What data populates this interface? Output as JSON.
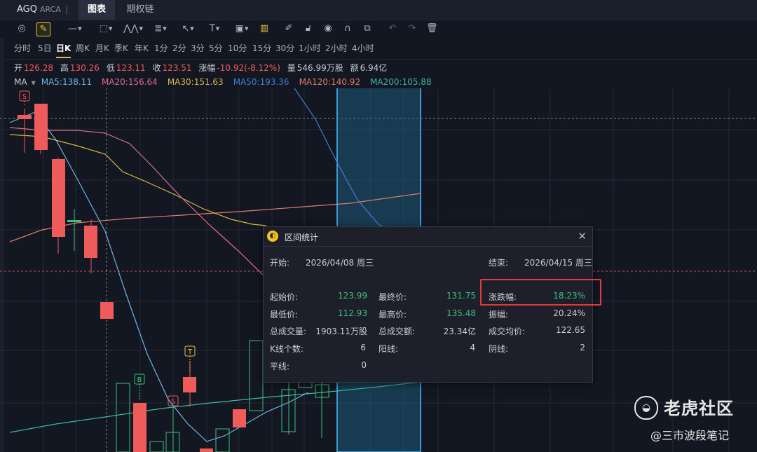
{
  "window": {
    "ticker": "AGQ",
    "exchange": "ARCA",
    "tabs": [
      {
        "label": "图表",
        "active": true
      },
      {
        "label": "期权链",
        "active": false
      }
    ]
  },
  "toolbar": {
    "icons": [
      "crosshair-icon",
      "draw-pen-icon",
      "line-icon",
      "rectangle-icon",
      "pattern-icon",
      "fib-icon",
      "arrow-icon",
      "text-icon",
      "annotation-icon",
      "indicator-icon",
      "brush-icon",
      "lock-icon",
      "eye-icon",
      "magnet-icon",
      "layers-icon",
      "undo-icon",
      "redo-icon",
      "trash-icon"
    ]
  },
  "periods": [
    {
      "label": "分时",
      "active": false
    },
    {
      "label": "5日",
      "active": false
    },
    {
      "label": "日K",
      "active": true
    },
    {
      "label": "周K",
      "active": false
    },
    {
      "label": "月K",
      "active": false
    },
    {
      "label": "季K",
      "active": false
    },
    {
      "label": "年K",
      "active": false
    },
    {
      "label": "1分",
      "active": false
    },
    {
      "label": "2分",
      "active": false
    },
    {
      "label": "3分",
      "active": false
    },
    {
      "label": "5分",
      "active": false
    },
    {
      "label": "10分",
      "active": false
    },
    {
      "label": "15分",
      "active": false
    },
    {
      "label": "30分",
      "active": false
    },
    {
      "label": "1小时",
      "active": false
    },
    {
      "label": "2小时",
      "active": false
    },
    {
      "label": "4小时",
      "active": false
    }
  ],
  "quote": {
    "open_label": "开",
    "open": "126.28",
    "high_label": "高",
    "high": "130.26",
    "low_label": "低",
    "low": "123.11",
    "close_label": "收",
    "close": "123.51",
    "change_label": "涨幅",
    "change": "-10.92(-8.12%)",
    "volume_label": "量",
    "volume": "546.99万股",
    "amount_label": "额",
    "amount": "6.94亿"
  },
  "ma": {
    "label": "MA",
    "items": [
      {
        "text": "MA5:138.11",
        "color": "#6fb3e6"
      },
      {
        "text": "MA20:156.64",
        "color": "#e06b8d"
      },
      {
        "text": "MA30:151.63",
        "color": "#d9b84a"
      },
      {
        "text": "MA50:193.36",
        "color": "#3f7fd1"
      },
      {
        "text": "MA120:140.92",
        "color": "#e07b6a"
      },
      {
        "text": "MA200:105.88",
        "color": "#3bb7a2"
      }
    ]
  },
  "markers": {
    "s_top": "S",
    "b": "B",
    "s_low": "S",
    "t": "T"
  },
  "dialog": {
    "title": "区间统计",
    "start_label": "开始:",
    "start": "2026/04/08 周三",
    "end_label": "结束:",
    "end": "2026/04/15 周三",
    "rows": [
      [
        {
          "label": "起始价:",
          "value": "123.99",
          "tone": "green"
        },
        {
          "label": "最终价:",
          "value": "131.75",
          "tone": "green"
        },
        {
          "label": "涨跌幅:",
          "value": "18.23%",
          "tone": "green"
        }
      ],
      [
        {
          "label": "最低价:",
          "value": "112.93",
          "tone": "green"
        },
        {
          "label": "最高价:",
          "value": "135.48",
          "tone": "green"
        },
        {
          "label": "振幅:",
          "value": "20.24%",
          "tone": "plain"
        }
      ],
      [
        {
          "label": "总成交量:",
          "value": "1903.11万股",
          "tone": "plain"
        },
        {
          "label": "总成交额:",
          "value": "23.34亿",
          "tone": "plain"
        },
        {
          "label": "成交均价:",
          "value": "122.65",
          "tone": "plain"
        }
      ],
      [
        {
          "label": "K线个数:",
          "value": "6",
          "tone": "plain"
        },
        {
          "label": "阳线:",
          "value": "4",
          "tone": "plain"
        },
        {
          "label": "阴线:",
          "value": "2",
          "tone": "plain"
        }
      ],
      [
        {
          "label": "平线:",
          "value": "0",
          "tone": "plain"
        }
      ]
    ]
  },
  "watermark": {
    "brand": "老虎社区",
    "author": "@三市波段笔记"
  },
  "colors": {
    "up": "#3fbf7f",
    "down": "#ef5a5a",
    "accent": "#e4c13b",
    "highlight_box": "#e23b3b",
    "selection_band": "#1e5a78"
  }
}
